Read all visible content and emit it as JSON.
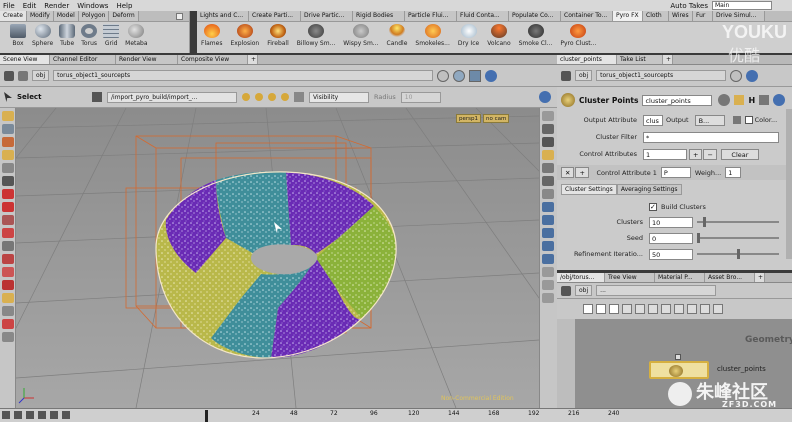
{
  "menubar": {
    "items": [
      "File",
      "Edit",
      "Render",
      "Windows",
      "Help"
    ],
    "takes_label": "Auto Takes",
    "takes_value": "Main"
  },
  "shelf_left": {
    "tabs": [
      "Create",
      "Modify",
      "Model",
      "Polygon",
      "Deform"
    ],
    "tools": [
      "Box",
      "Sphere",
      "Tube",
      "Torus",
      "Grid",
      "Metaba"
    ]
  },
  "shelf_right": {
    "tabs": [
      "Lights and C...",
      "Create Parti...",
      "Drive Partic...",
      "Rigid Bodies",
      "Particle Flui...",
      "Fluid Conta...",
      "Populate Co...",
      "Container To...",
      "Pyro FX",
      "Cloth",
      "Wires",
      "Fur",
      "Drive Simul..."
    ],
    "tools": [
      "Flames",
      "Explosion",
      "Fireball",
      "Billowy Sm...",
      "Wispy Sm...",
      "Candle",
      "Smokeles...",
      "Dry Ice",
      "Volcano",
      "Smoke Cl...",
      "Pyro Clust..."
    ]
  },
  "scene_tabs": [
    "Scene View",
    "Channel Editor",
    "Render View",
    "Composite View"
  ],
  "scene_path": {
    "root": "obj",
    "node": "torus_object1_sourcepts"
  },
  "viewer_toolbar": {
    "select_label": "Select",
    "path_value": "/import_pyro_build/import_...",
    "visibility": "Visibility",
    "radius_label": "Radius",
    "radius_value": "10"
  },
  "viewport": {
    "persp": "persp1",
    "cam": "no cam",
    "watermark": "Non-Commercial Edition"
  },
  "param_tabs": [
    "cluster_points",
    "Take List"
  ],
  "param_path": {
    "root": "obj",
    "node": "torus_object1_sourcepts"
  },
  "node_header": {
    "type": "Cluster Points",
    "name": "cluster_points"
  },
  "params": {
    "output_attribute_label": "Output Attribute",
    "output_attribute_value": "clus",
    "output_label": "Output",
    "output_value": "B...",
    "color_label": "Color...",
    "cluster_filter_label": "Cluster Filter",
    "cluster_filter_value": "*",
    "control_attributes_label": "Control Attributes",
    "control_attributes_value": "1",
    "clear_label": "Clear",
    "control_attribute1_label": "Control Attribute 1",
    "control_attribute1_value": "P",
    "weight_label": "Weigh...",
    "weight_value": "1",
    "subtabs": [
      "Cluster Settings",
      "Averaging Settings"
    ],
    "build_clusters_label": "Build Clusters",
    "clusters_label": "Clusters",
    "clusters_value": "10",
    "seed_label": "Seed",
    "seed_value": "0",
    "refinement_label": "Refinement Iteratio...",
    "refinement_value": "50"
  },
  "network_tabs": [
    "/obj/torus...",
    "Tree View",
    "Material P...",
    "Asset Bro..."
  ],
  "network_path": {
    "root": "obj",
    "node": "..."
  },
  "network": {
    "geometry_label": "Geometry",
    "node_label": "cluster_points"
  },
  "timeline": {
    "ticks": [
      "24",
      "48",
      "72",
      "96",
      "120",
      "144",
      "168",
      "192",
      "216",
      "240"
    ]
  },
  "overlay": {
    "youku": "YOUKU",
    "youku_cn": "优酷",
    "zf3d": "朱峰社区",
    "zf3d_url": "ZF3D.COM"
  },
  "colors": {
    "cluster_purple": "#6a2bb5",
    "cluster_teal": "#3f8e9a",
    "cluster_olive": "#b9b84a",
    "cluster_green": "#8bb23a",
    "bbox_orange": "#d46a30"
  }
}
